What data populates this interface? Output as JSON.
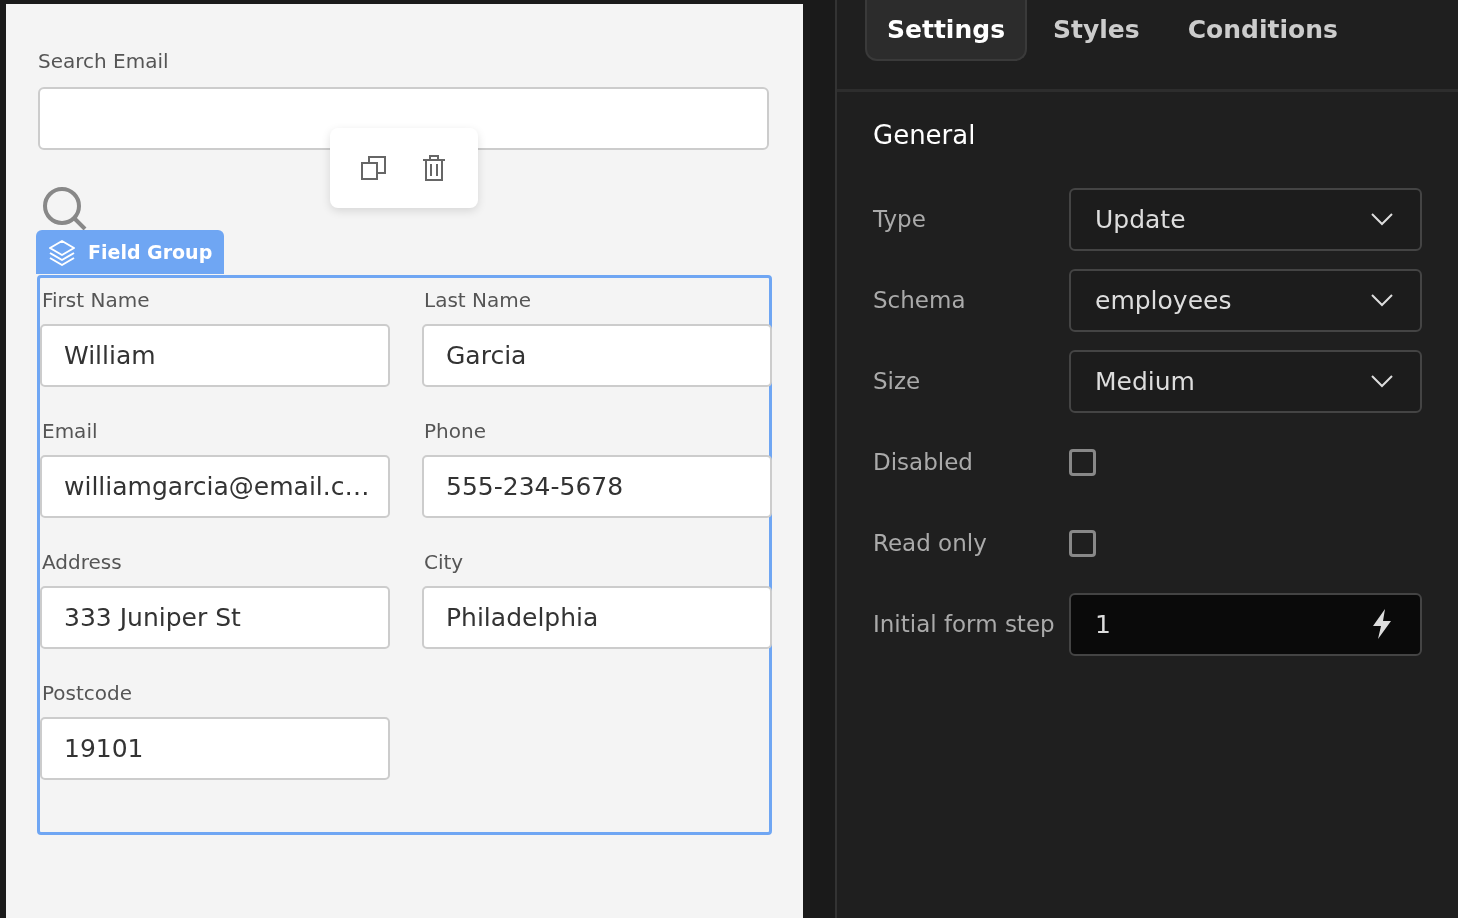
{
  "canvas": {
    "search_field": {
      "label": "Search Email"
    },
    "field_group": {
      "tag": "Field Group",
      "fields": [
        {
          "label": "First Name",
          "value": "William"
        },
        {
          "label": "Last Name",
          "value": "Garcia"
        },
        {
          "label": "Email",
          "value": "williamgarcia@email.c…"
        },
        {
          "label": "Phone",
          "value": "555-234-5678"
        },
        {
          "label": "Address",
          "value": "333 Juniper St"
        },
        {
          "label": "City",
          "value": "Philadelphia"
        },
        {
          "label": "Postcode",
          "value": "19101"
        }
      ]
    }
  },
  "panel": {
    "tabs": [
      {
        "label": "Settings",
        "selected": true
      },
      {
        "label": "Styles",
        "selected": false
      },
      {
        "label": "Conditions",
        "selected": false
      }
    ],
    "section": "General",
    "rows": [
      {
        "kind": "select",
        "label": "Type",
        "value": "Update"
      },
      {
        "kind": "select",
        "label": "Schema",
        "value": "employees"
      },
      {
        "kind": "select",
        "label": "Size",
        "value": "Medium"
      },
      {
        "kind": "checkbox",
        "label": "Disabled",
        "checked": false
      },
      {
        "kind": "checkbox",
        "label": "Read only",
        "checked": false
      },
      {
        "kind": "input",
        "label": "Initial form step",
        "value": "1"
      }
    ]
  }
}
